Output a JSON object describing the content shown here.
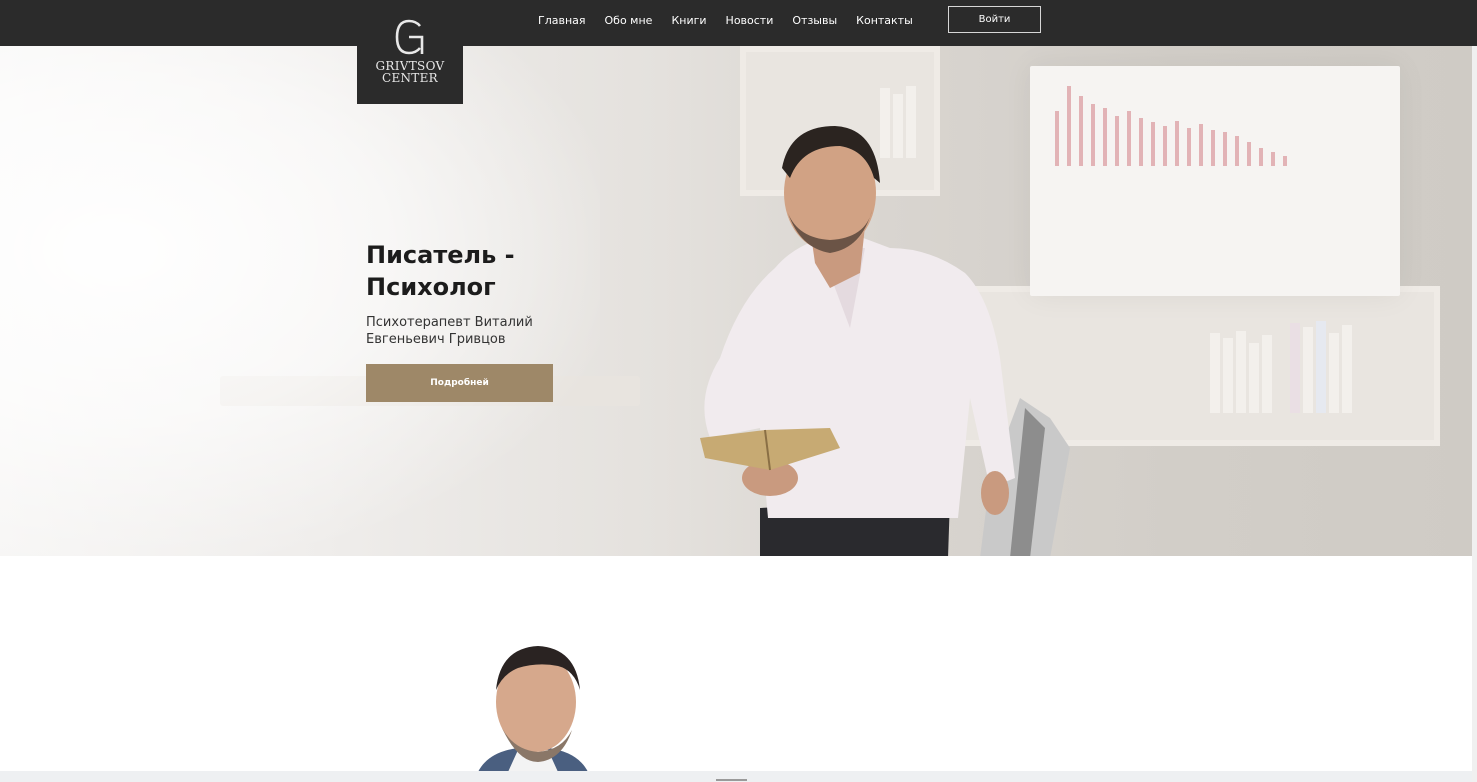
{
  "logo": {
    "letter": "G",
    "line1": "GRIVTSOV",
    "line2": "CENTER"
  },
  "nav": {
    "items": [
      "Главная",
      "Обо мне",
      "Книги",
      "Новости",
      "Отзывы",
      "Контакты"
    ],
    "login_label": "Войти"
  },
  "hero": {
    "title_line1": "Писатель -",
    "title_line2": "Психолог",
    "subtitle_line1": "Психотерапевт Виталий",
    "subtitle_line2": "Евгеньевич Гривцов",
    "button_label": "Подробней"
  },
  "colors": {
    "header_bg": "#2b2b2b",
    "accent_button": "#9e8868"
  }
}
